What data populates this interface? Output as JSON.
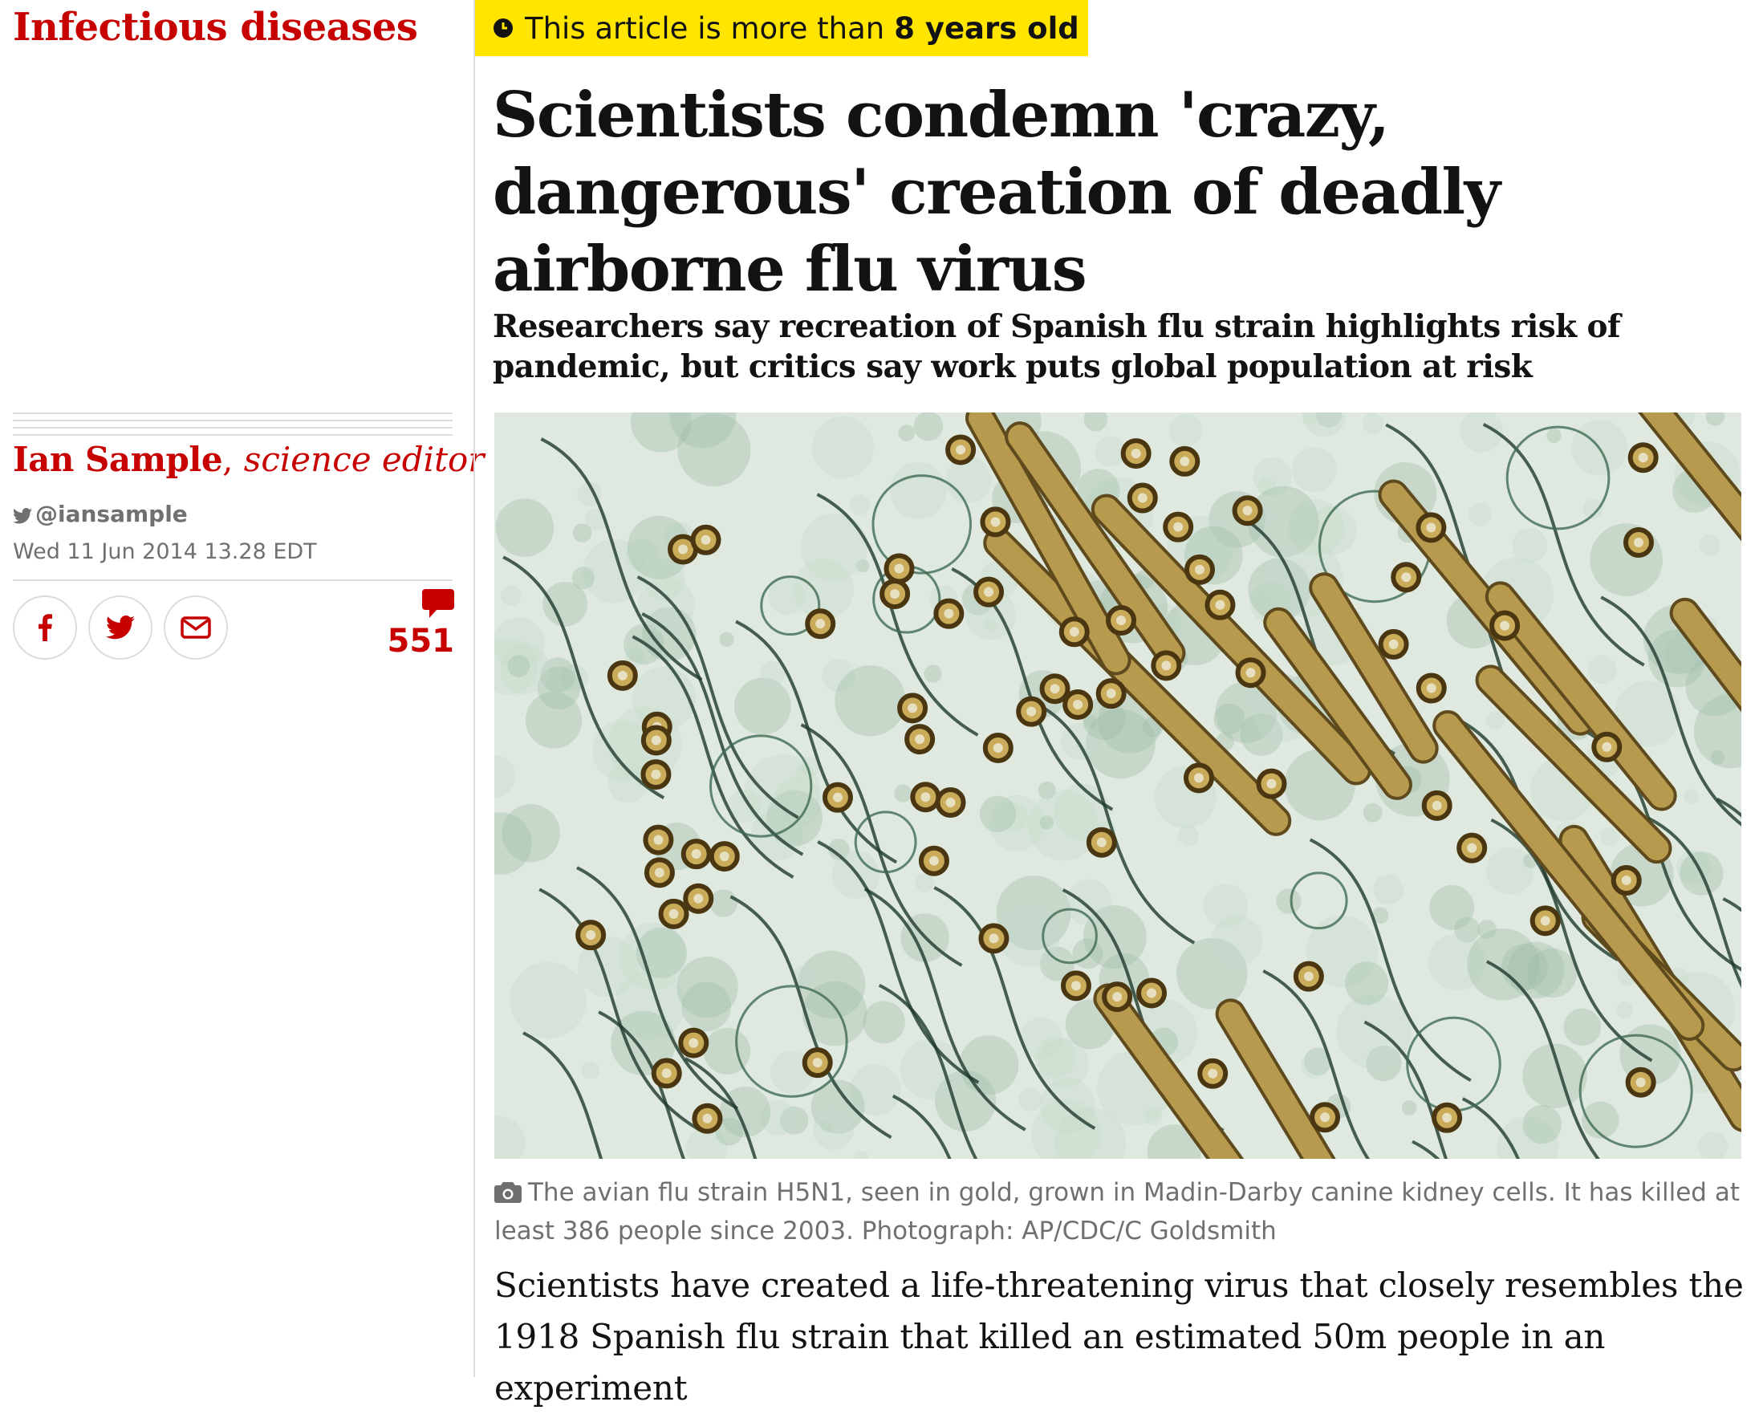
{
  "section": {
    "label": "Infectious diseases"
  },
  "age_banner": {
    "prefix": "This article is more than",
    "highlight": "8 years old"
  },
  "headline": "Scientists condemn 'crazy, dangerous' creation of deadly airborne flu virus",
  "standfirst": "Researchers say recreation of Spanish flu strain highlights risk of pandemic, but critics say work puts global population at risk",
  "byline": {
    "name": "Ian Sample",
    "separator": ",",
    "role": "science editor"
  },
  "twitter": {
    "handle": "@iansample"
  },
  "dateline": "Wed 11 Jun 2014 13.28 EDT",
  "share": {
    "facebook_icon": "facebook-icon",
    "twitter_icon": "twitter-icon",
    "email_icon": "email-icon"
  },
  "comments": {
    "count": "551",
    "icon": "speech-bubble-icon"
  },
  "image": {
    "description_icon": "camera-icon"
  },
  "caption": "The avian flu strain H5N1, seen in gold, grown in Madin-Darby canine kidney cells. It has killed at least 386 people since 2003. Photograph: AP/CDC/C Goldsmith",
  "body": "Scientists have created a life-threatening virus that closely resembles the 1918 Spanish flu strain that killed an estimated 50m people in an experiment",
  "colors": {
    "accent": "#c70000",
    "banner": "#ffe500",
    "muted": "#707070",
    "rule": "#dcdcdc"
  }
}
